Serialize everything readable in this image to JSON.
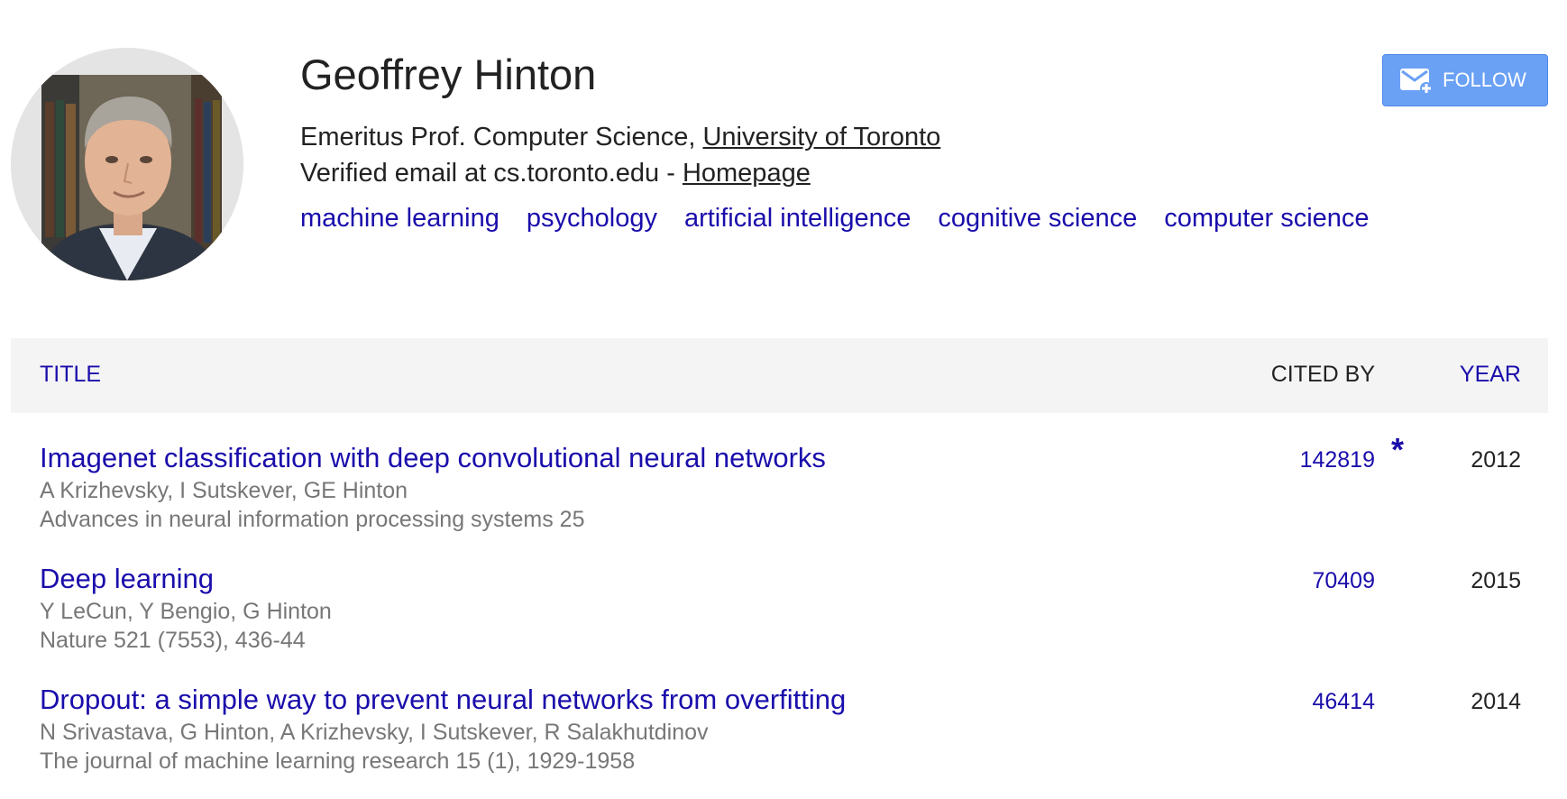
{
  "profile": {
    "name": "Geoffrey Hinton",
    "affiliation_prefix": "Emeritus Prof. Computer Science, ",
    "affiliation_link": "University of Toronto",
    "email_text": "Verified email at cs.toronto.edu - ",
    "homepage_link": "Homepage",
    "interests": [
      "machine learning",
      "psychology",
      "artificial intelligence",
      "cognitive science",
      "computer science"
    ]
  },
  "follow_button": {
    "label": "FOLLOW",
    "icon": "mail-plus-icon"
  },
  "table": {
    "headers": {
      "title": "TITLE",
      "cited_by": "CITED BY",
      "year": "YEAR"
    },
    "rows": [
      {
        "title": "Imagenet classification with deep convolutional neural networks",
        "authors": "A Krizhevsky, I Sutskever, GE Hinton",
        "venue": "Advances in neural information processing systems 25",
        "cited_by": "142819",
        "star": "*",
        "year": "2012"
      },
      {
        "title": "Deep learning",
        "authors": "Y LeCun, Y Bengio, G Hinton",
        "venue": "Nature 521 (7553), 436-44",
        "cited_by": "70409",
        "star": "",
        "year": "2015"
      },
      {
        "title": "Dropout: a simple way to prevent neural networks from overfitting",
        "authors": "N Srivastava, G Hinton, A Krizhevsky, I Sutskever, R Salakhutdinov",
        "venue": "The journal of machine learning research 15 (1), 1929-1958",
        "cited_by": "46414",
        "star": "",
        "year": "2014"
      }
    ]
  },
  "colors": {
    "link": "#1a0dab",
    "button": "#6aa1f5",
    "header_bg": "#f4f4f4",
    "meta_text": "#777777"
  }
}
